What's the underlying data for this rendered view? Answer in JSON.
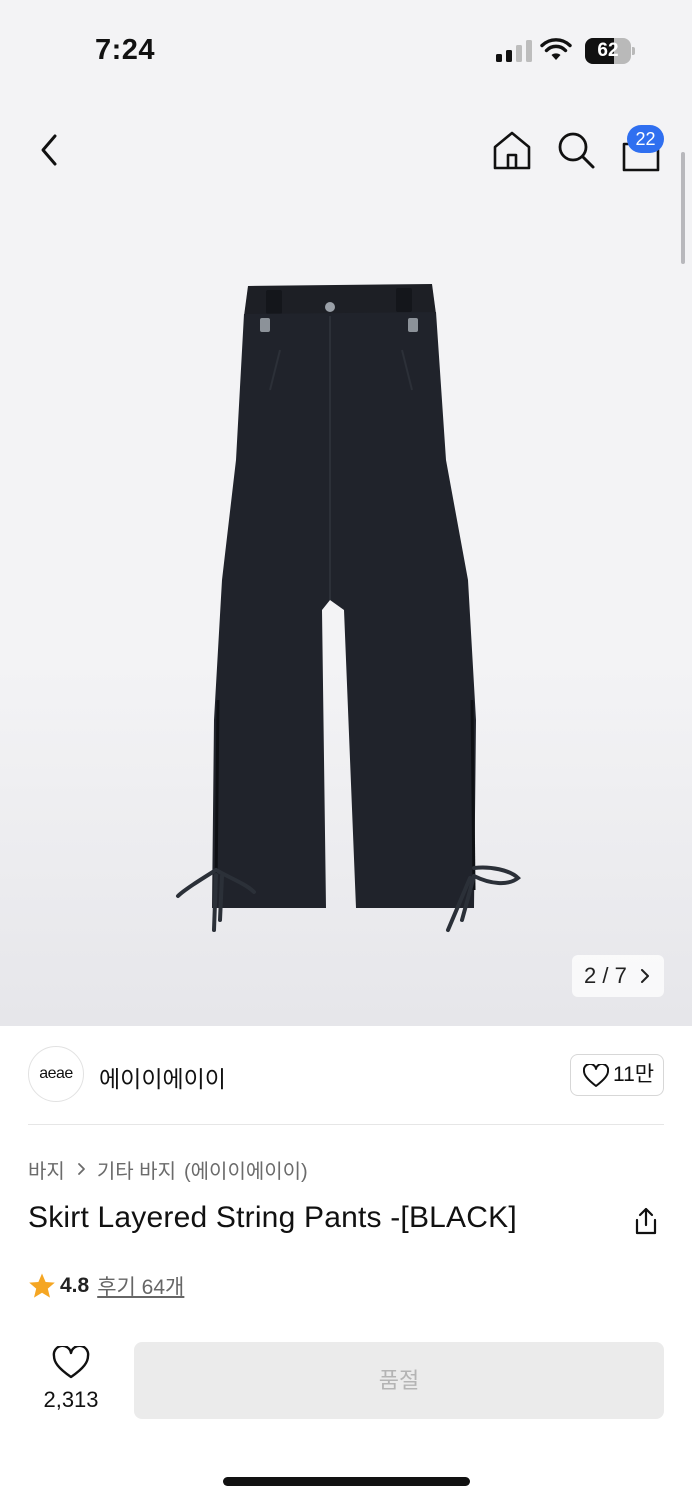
{
  "status_bar": {
    "time": "7:24",
    "battery": "62",
    "battery_level": 0.62,
    "icons": [
      "cellular-signal-icon",
      "wifi-icon",
      "battery-icon"
    ]
  },
  "header": {
    "icons": [
      "back-arrow-icon",
      "home-icon",
      "search-icon",
      "shopping-bag-icon"
    ],
    "cart_badge": "22"
  },
  "gallery": {
    "page_counter": "2 / 7",
    "current_page": 2,
    "total_pages": 7
  },
  "brand": {
    "logo_text": "aeae",
    "name": "에이이에이이",
    "like_count": "11만"
  },
  "product": {
    "breadcrumb": {
      "category": "바지",
      "subcategory": "기타 바지",
      "brand_in_parens": "(에이이에이이)"
    },
    "title": "Skirt Layered String Pants -[BLACK]",
    "rating": "4.8",
    "reviews": "후기 64개"
  },
  "bottom_bar": {
    "wish_count": "2,313",
    "soldout_label": "품절"
  },
  "colors": {
    "accent_blue": "#2f6ff0",
    "star_orange": "#f5a623",
    "disabled_bg": "#ebebeb",
    "disabled_text": "#b4b4b4"
  }
}
